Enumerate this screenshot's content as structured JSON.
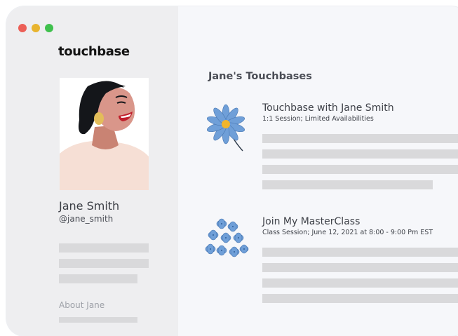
{
  "window": {
    "controls": {
      "close_color": "#ec5f57",
      "minimize_color": "#e8b42f",
      "maximize_color": "#3fc04d"
    }
  },
  "sidebar": {
    "brand": "touchbase",
    "profile": {
      "name": "Jane Smith",
      "handle": "@jane_smith"
    },
    "about_label": "About Jane"
  },
  "main": {
    "title": "Jane's Touchbases",
    "cards": [
      {
        "title": "Touchbase with Jane Smith",
        "subtitle": "1:1 Session; Limited Availabilities",
        "icon": "blue-daisy-icon"
      },
      {
        "title": "Join My MasterClass",
        "subtitle": "Class Session; June 12, 2021 at 8:00 - 9:00 Pm EST",
        "icon": "blue-hydrangea-icon"
      }
    ]
  },
  "colors": {
    "sidebar_bg": "#eeeef0",
    "main_bg": "#f6f7fa",
    "placeholder_bar": "#d9d9db",
    "flower_blue": "#6f9fd8",
    "flower_center": "#f1b52c"
  }
}
